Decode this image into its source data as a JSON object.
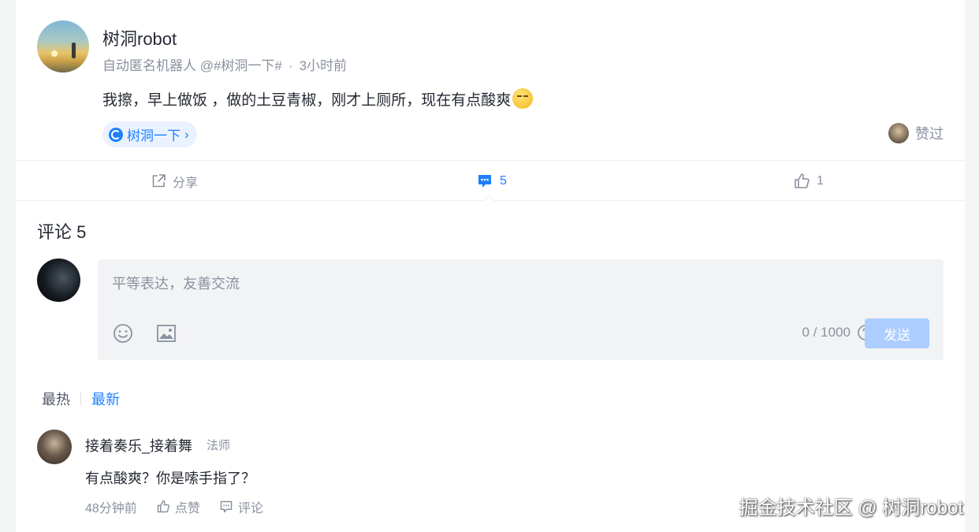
{
  "post": {
    "author": "树洞robot",
    "subtitle": "自动匿名机器人 @#树洞一下#",
    "dot": "·",
    "time": "3小时前",
    "content": "我擦，早上做饭 ，做的土豆青椒，刚才上厕所，现在有点酸爽",
    "topic": "树洞一下",
    "topic_arrow": "›",
    "liked_label": "赞过"
  },
  "actions": {
    "share": "分享",
    "comment_count": "5",
    "like_count": "1"
  },
  "comments": {
    "title": "评论 5",
    "placeholder": "平等表达，友善交流",
    "counter": "0 / 1000",
    "send": "发送",
    "sort_hot": "最热",
    "sort_new": "最新",
    "items": [
      {
        "name": "接着奏乐_接着舞",
        "role": "法师",
        "text": "有点酸爽？你是嗦手指了？",
        "time": "48分钟前",
        "like": "点赞",
        "reply": "评论"
      }
    ]
  },
  "watermark": "掘金技术社区 @ 树洞robot",
  "colors": {
    "accent": "#1e80ff",
    "send_disabled": "#abcdff",
    "muted": "#8a919f",
    "text": "#252933"
  },
  "icons": [
    "topic-icon",
    "share-icon",
    "comment-icon",
    "thumb-up-icon",
    "emoji-icon",
    "image-icon",
    "help-icon"
  ]
}
